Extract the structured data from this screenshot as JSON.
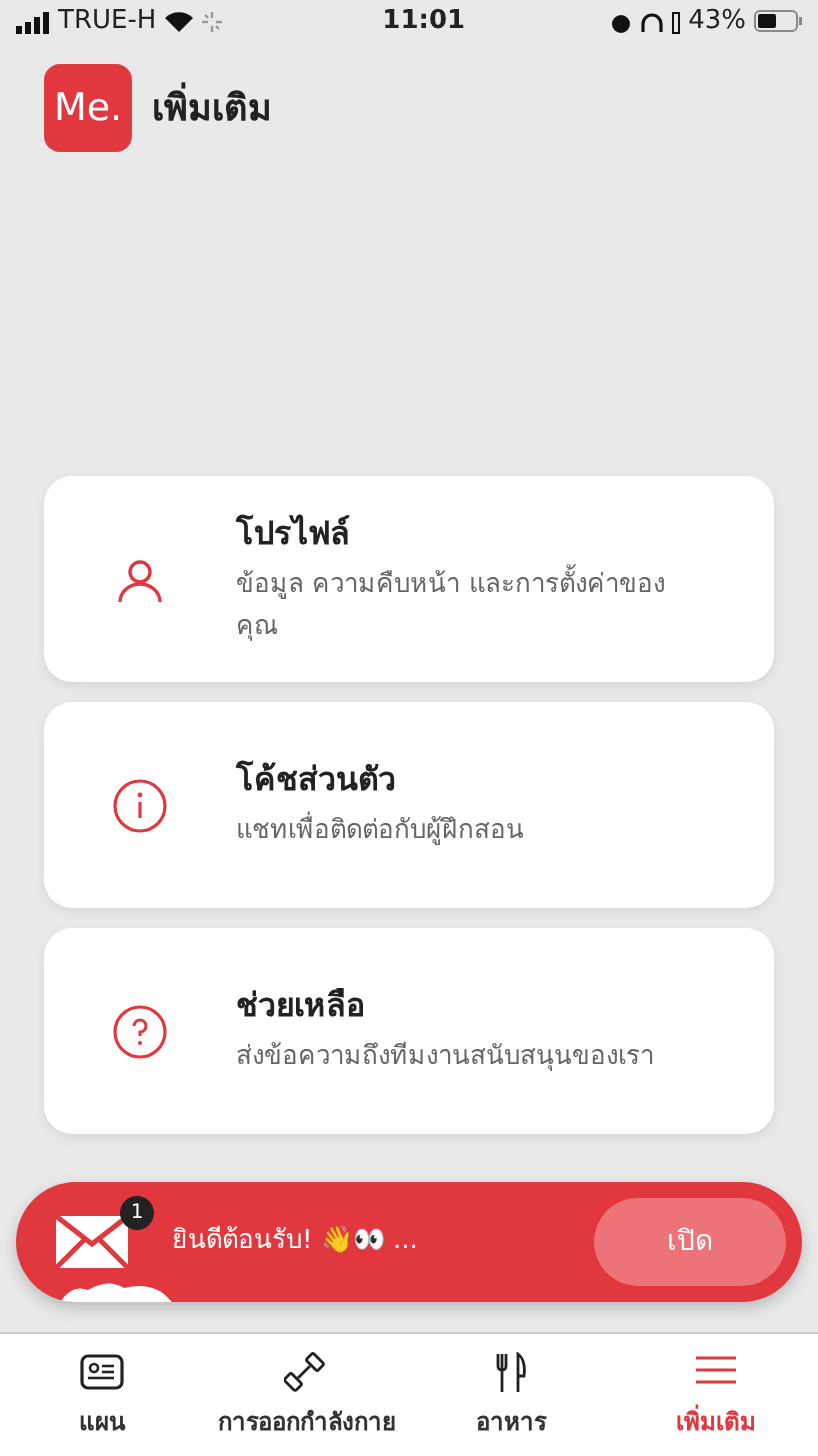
{
  "status_bar": {
    "carrier": "TRUE-H",
    "time": "11:01",
    "battery": "43%"
  },
  "header": {
    "logo": "Me.",
    "title": "เพิ่มเติม"
  },
  "menu_cards": [
    {
      "kind": "person",
      "title": "โปรไฟล์",
      "subtitle": "ข้อมูล ความคืบหน้า และการตั้งค่าของคุณ"
    },
    {
      "kind": "info",
      "title": "โค้ชส่วนตัว",
      "subtitle": "แชทเพื่อติดต่อกับผู้ฝึกสอน"
    },
    {
      "kind": "help",
      "title": "ช่วยเหลือ",
      "subtitle": "ส่งข้อความถึงทีมงานสนับสนุนของเรา"
    }
  ],
  "message_banner": {
    "badge": "1",
    "text": "ยินดีต้อนรับ! 👋👀 ...",
    "button": "เปิด"
  },
  "tab_bar": [
    {
      "kind": "plan",
      "label": "แผน",
      "selected": false
    },
    {
      "kind": "workout",
      "label": "การออกกำลังกาย",
      "selected": false
    },
    {
      "kind": "food",
      "label": "อาหาร",
      "selected": false
    },
    {
      "kind": "more",
      "label": "เพิ่มเติม",
      "selected": true
    }
  ]
}
